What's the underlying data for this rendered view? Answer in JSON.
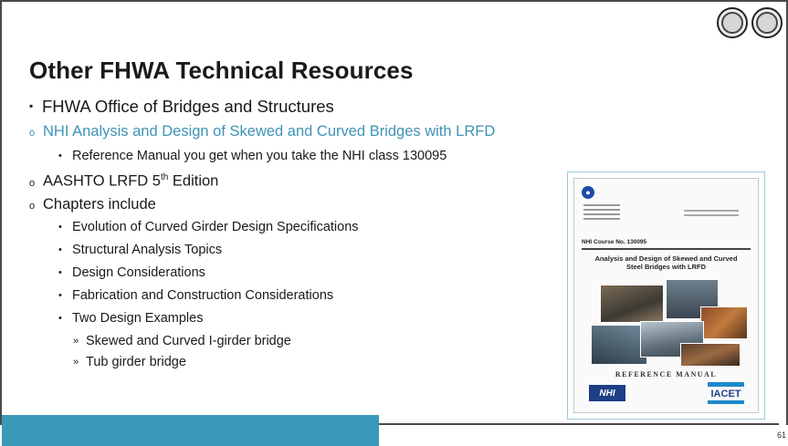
{
  "slide": {
    "title": "Other FHWA Technical Resources",
    "page_number": "61"
  },
  "bullets": {
    "b1": "FHWA Office of Bridges and Structures",
    "b1_1": "NHI Analysis and Design of Skewed and Curved Bridges with LRFD",
    "b1_1_1": "Reference Manual you get when you take the NHI class 130095",
    "b1_2_pre": "AASHTO LRFD 5",
    "b1_2_sup": "th",
    "b1_2_post": " Edition",
    "b1_3": "Chapters include",
    "chapters": [
      "Evolution of Curved Girder Design Specifications",
      "Structural Analysis Topics",
      "Design Considerations",
      "Fabrication and Construction Considerations",
      "Two Design Examples"
    ],
    "examples": [
      "Skewed and Curved I-girder bridge",
      "Tub girder bridge"
    ]
  },
  "cover": {
    "course_no": "NHI Course No. 130095",
    "title_line1": "Analysis and Design of Skewed and Curved",
    "title_line2": "Steel Bridges with LRFD",
    "ref_manual": "REFERENCE MANUAL",
    "nhi_logo": "NHI",
    "iacet_logo": "IACET"
  },
  "glyphs": {
    "square_bullet": "▪",
    "circle_bullet": "o",
    "dot_bullet": "•",
    "chevron_bullet": "»"
  },
  "colors": {
    "accent": "#3a98b9",
    "link": "#3f93b6"
  }
}
